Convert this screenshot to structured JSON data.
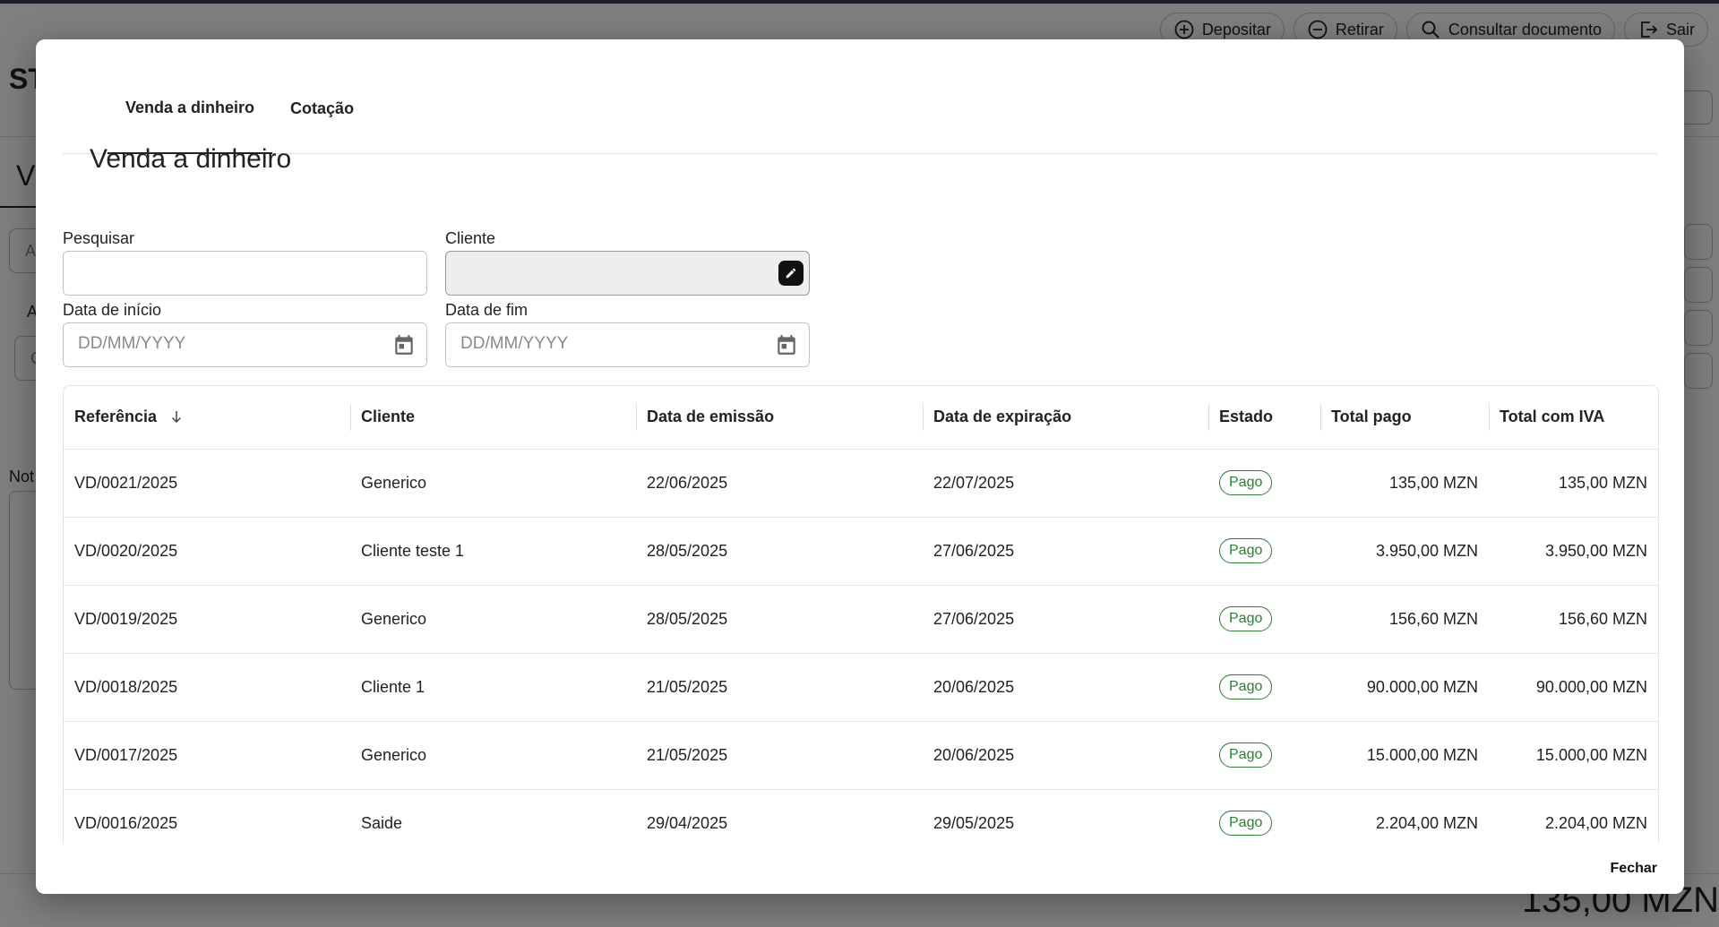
{
  "background": {
    "actions": [
      "Depositar",
      "Retirar",
      "Consultar documento",
      "Sair"
    ],
    "title_fragment": "ST",
    "tab_fragment": "V",
    "notes_fragment": "Not",
    "field_fragment_a": "A",
    "field_fragment_b": "A",
    "field_fragment_c": "C",
    "total": "135,00 MZN"
  },
  "modal": {
    "tabs": [
      "Venda a dinheiro",
      "Cotação"
    ],
    "heading": "Venda a dinheiro",
    "filters": {
      "search_label": "Pesquisar",
      "search_value": "",
      "client_label": "Cliente",
      "client_value": "",
      "start_label": "Data de início",
      "start_placeholder": "DD/MM/YYYY",
      "end_label": "Data de fim",
      "end_placeholder": "DD/MM/YYYY"
    },
    "table": {
      "headers": [
        "Referência",
        "Cliente",
        "Data de emissão",
        "Data de expiração",
        "Estado",
        "Total pago",
        "Total com IVA"
      ],
      "rows": [
        [
          "VD/0021/2025",
          "Generico",
          "22/06/2025",
          "22/07/2025",
          "Pago",
          "135,00 MZN",
          "135,00 MZN"
        ],
        [
          "VD/0020/2025",
          "Cliente teste 1",
          "28/05/2025",
          "27/06/2025",
          "Pago",
          "3.950,00 MZN",
          "3.950,00 MZN"
        ],
        [
          "VD/0019/2025",
          "Generico",
          "28/05/2025",
          "27/06/2025",
          "Pago",
          "156,60 MZN",
          "156,60 MZN"
        ],
        [
          "VD/0018/2025",
          "Cliente 1",
          "21/05/2025",
          "20/06/2025",
          "Pago",
          "90.000,00 MZN",
          "90.000,00 MZN"
        ],
        [
          "VD/0017/2025",
          "Generico",
          "21/05/2025",
          "20/06/2025",
          "Pago",
          "15.000,00 MZN",
          "15.000,00 MZN"
        ],
        [
          "VD/0016/2025",
          "Saide",
          "29/04/2025",
          "29/05/2025",
          "Pago",
          "2.204,00 MZN",
          "2.204,00 MZN"
        ]
      ]
    },
    "close_label": "Fechar"
  }
}
